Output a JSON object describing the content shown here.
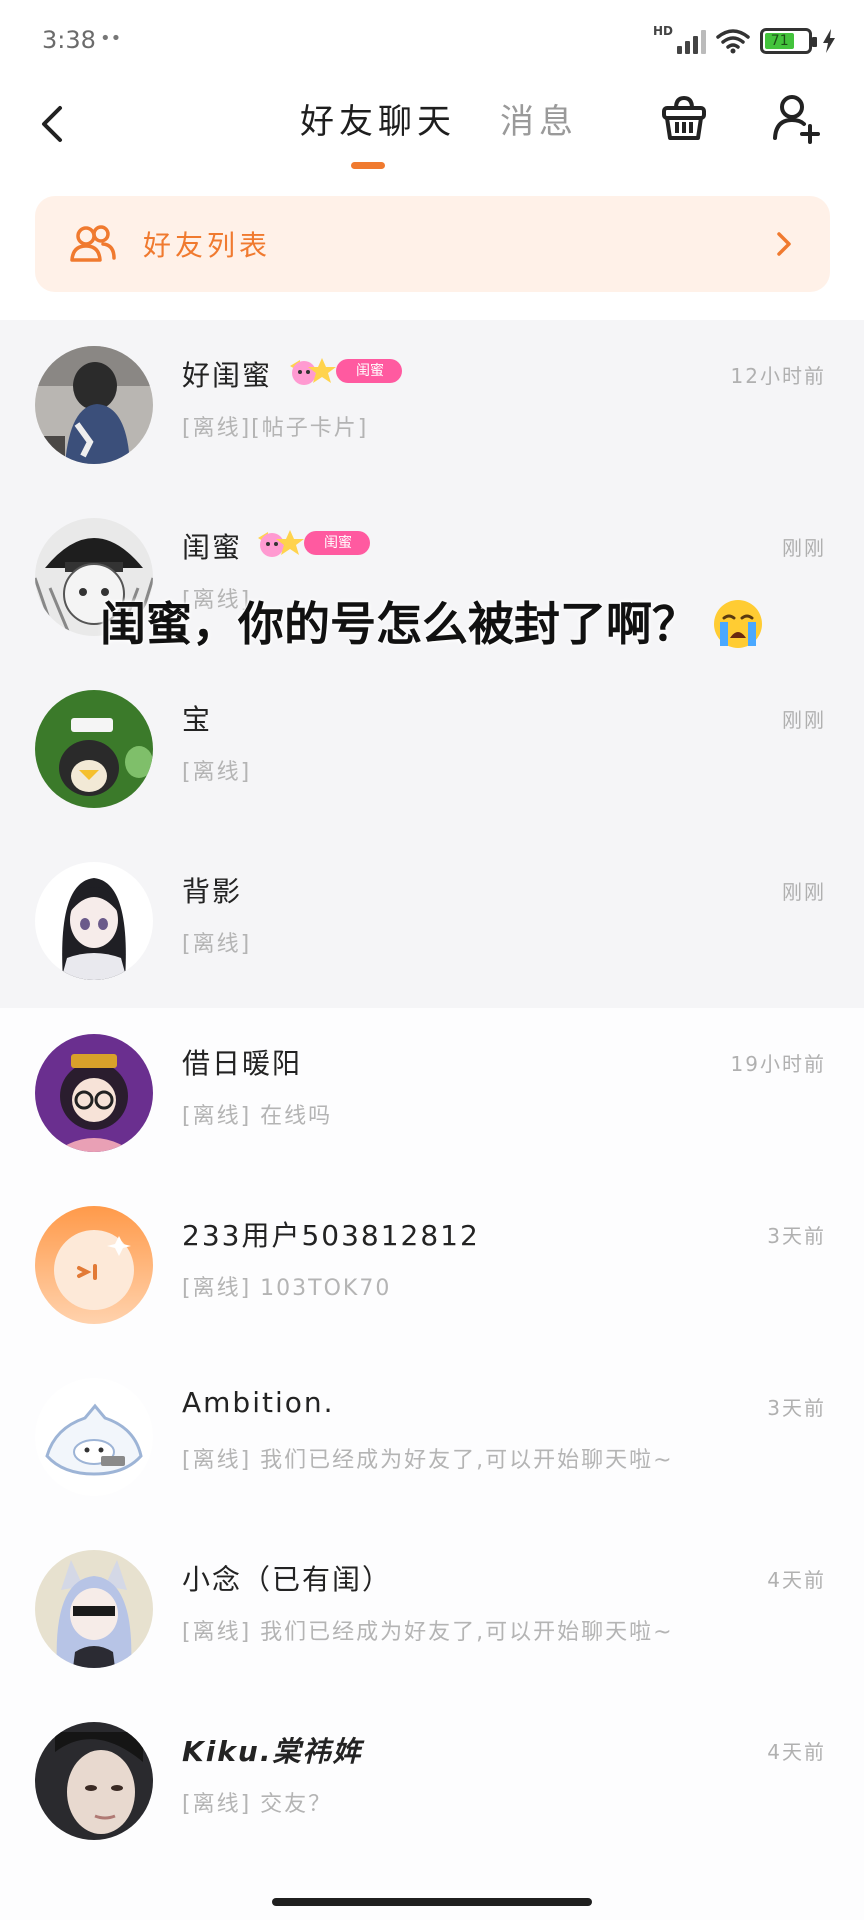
{
  "status_bar": {
    "time": "3:38",
    "extra": "••",
    "network": "HD",
    "battery": "71"
  },
  "header": {
    "tabs": [
      {
        "label": "好友聊天",
        "active": true
      },
      {
        "label": "消息",
        "active": false
      }
    ],
    "accent_color": "#f07a2f"
  },
  "friend_list_banner": {
    "label": "好友列表"
  },
  "caption": {
    "text": "闺蜜，你的号怎么被封了啊？"
  },
  "chats": [
    {
      "name": "好闺蜜",
      "badge": "闺蜜",
      "preview": "[离线][帖子卡片]",
      "time": "12小时前"
    },
    {
      "name": "闺蜜",
      "badge": "闺蜜",
      "preview": "[离线]",
      "time": "刚刚"
    },
    {
      "name": "宝",
      "preview": "[离线]",
      "time": "刚刚"
    },
    {
      "name": "背影",
      "preview": "[离线]",
      "time": "刚刚"
    },
    {
      "name": "借日暖阳",
      "preview": "[离线] 在线吗",
      "time": "19小时前"
    },
    {
      "name": "233用户503812812",
      "preview": "[离线] 103TOK70",
      "time": "3天前"
    },
    {
      "name": "Ambition.",
      "preview": "[离线] 我们已经成为好友了,可以开始聊天啦~",
      "time": "3天前"
    },
    {
      "name": "小念（已有闺）",
      "preview": "[离线] 我们已经成为好友了,可以开始聊天啦~",
      "time": "4天前"
    },
    {
      "name": "Kiku.棠祎姩",
      "preview": "[离线] 交友？",
      "time": "4天前"
    }
  ]
}
